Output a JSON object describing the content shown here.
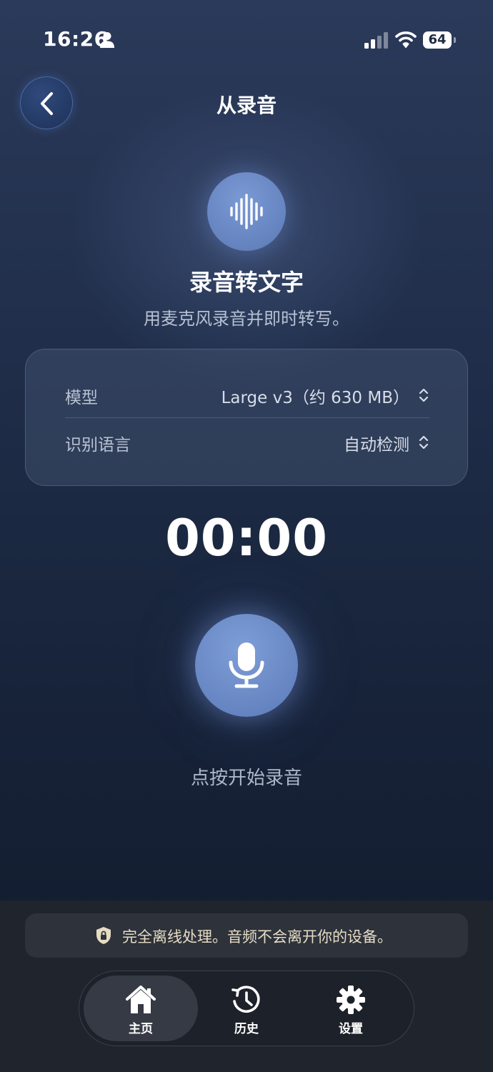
{
  "status_bar": {
    "time": "16:26",
    "battery": "64",
    "icons": [
      "person-icon",
      "signal-icon",
      "wifi-icon",
      "battery-icon"
    ]
  },
  "header": {
    "title": "从录音",
    "back_icon": "chevron-left-icon"
  },
  "hero": {
    "icon": "waveform-icon",
    "title": "录音转文字",
    "subtitle": "用麦克风录音并即时转写。"
  },
  "settings": {
    "model_label": "模型",
    "model_value": "Large v3（约 630 MB）",
    "language_label": "识别语言",
    "language_value": "自动检测"
  },
  "timer": "00:00",
  "record": {
    "icon": "microphone-icon",
    "hint": "点按开始录音"
  },
  "notice": {
    "icon": "lock-shield-icon",
    "text": "完全离线处理。音频不会离开你的设备。"
  },
  "tabs": [
    {
      "label": "主页",
      "icon": "home-icon",
      "selected": true
    },
    {
      "label": "历史",
      "icon": "history-icon",
      "selected": false
    },
    {
      "label": "设置",
      "icon": "gear-icon",
      "selected": false
    }
  ],
  "colors": {
    "accent": "#6a89c6",
    "notice_text": "#e6dcc4",
    "tab_selected_bg": "#353a44"
  }
}
